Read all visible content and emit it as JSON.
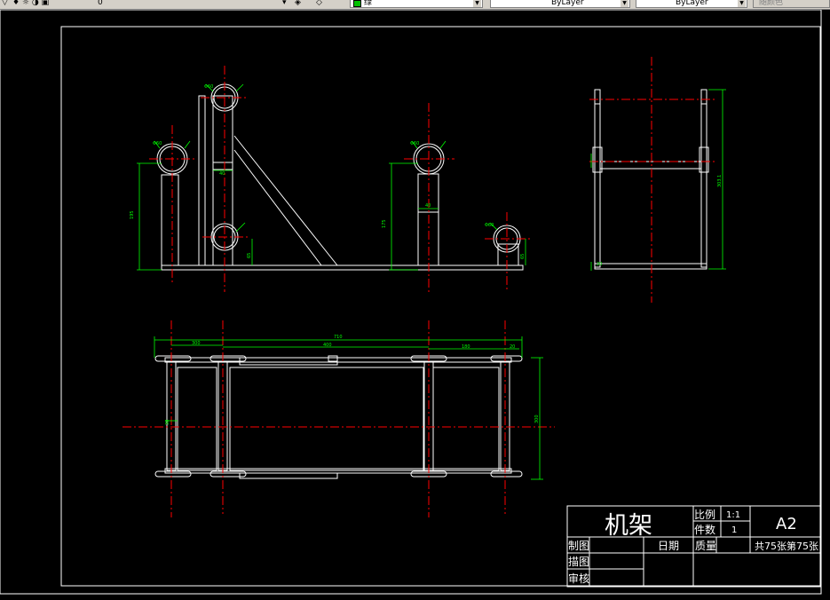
{
  "toolbar": {
    "layer_number": "0",
    "color_value": "绿",
    "linetype_value": "ByLayer",
    "lineweight_value": "ByLayer",
    "plotstyle_value": "随颜色",
    "colors": {
      "face": "#d4d0c8",
      "color_swatch": "#00c000"
    }
  },
  "drawing": {
    "background": "#000000",
    "line_color": "#ffffff",
    "center_line_color": "#ff0000",
    "dimension_color": "#00ff00",
    "dimensions": {
      "front_height_left": "195",
      "front_gap_top": "40",
      "front_gap_bottom": "65",
      "front_height_middle": "175",
      "front_width_middle": "40",
      "front_height_right": "65",
      "side_height": "303.1",
      "side_small": "20",
      "plan_total_width": "710",
      "plan_left_width": "300",
      "plan_mid_width": "400",
      "plan_right_width": "180",
      "plan_right_small": "20",
      "plan_height": "300",
      "plan_left_small": "30",
      "circle_labels": [
        "Φ60",
        "Φ60",
        "Φ60",
        "Φ60"
      ]
    }
  },
  "title_block": {
    "part_name": "机架",
    "scale_label": "比例",
    "scale_value": "1:1",
    "qty_label": "件数",
    "qty_value": "1",
    "sheet_size": "A2",
    "drawn_label": "制图",
    "date_label": "日期",
    "mass_label": "质量",
    "sheet_count": "共75张第75张",
    "traced_label": "描图",
    "checked_label": "审核"
  }
}
